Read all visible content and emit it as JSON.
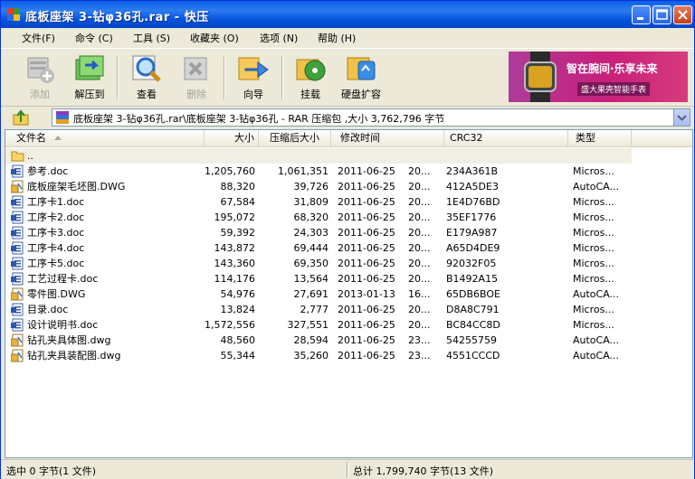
{
  "window": {
    "title": "底板座架 3-钻φ36孔.rar - 快压",
    "title_color": "#0A5FE6",
    "controls": [
      "minimize-icon",
      "maximize-icon",
      "close-icon"
    ]
  },
  "menu": [
    "文件(F)",
    "命令 (C)",
    "工具 (S)",
    "收藏夹 (O)",
    "选项 (N)",
    "帮助 (H)"
  ],
  "toolbar": {
    "add": "添加",
    "extract": "解压到",
    "view": "查看",
    "delete": "删除",
    "goto": "向导",
    "mount": "挂载",
    "disk": "硬盘扩容"
  },
  "ad": {
    "headline": "智在腕间·乐享未来",
    "sub": "盛大果壳智能手表"
  },
  "address": {
    "path": "底板座架 3-钻φ36孔.rar\\底板座架 3-钻φ36孔 - RAR 压缩包 ,大小 3,762,796 字节"
  },
  "columns": {
    "name": "文件名",
    "size": "大小",
    "packed": "压缩后大小",
    "modified": "修改时间",
    "crc": "CRC32",
    "type": "类型"
  },
  "parent_row": "..",
  "files": [
    {
      "name": "参考.doc",
      "icon": "word-doc-icon",
      "size": "1,205,760",
      "packed": "1,061,351",
      "date": "2011-06-25",
      "time": "20...",
      "crc": "234A361B",
      "type": "Micros..."
    },
    {
      "name": "底板座架毛坯图.DWG",
      "icon": "autocad-dwg-icon",
      "size": "88,320",
      "packed": "39,726",
      "date": "2011-06-25",
      "time": "20...",
      "crc": "412A5DE3",
      "type": "AutoCA..."
    },
    {
      "name": "工序卡1.doc",
      "icon": "word-doc-icon",
      "size": "67,584",
      "packed": "31,809",
      "date": "2011-06-25",
      "time": "20...",
      "crc": "1E4D76BD",
      "type": "Micros..."
    },
    {
      "name": "工序卡2.doc",
      "icon": "word-doc-icon",
      "size": "195,072",
      "packed": "68,320",
      "date": "2011-06-25",
      "time": "20...",
      "crc": "35EF1776",
      "type": "Micros..."
    },
    {
      "name": "工序卡3.doc",
      "icon": "word-doc-icon",
      "size": "59,392",
      "packed": "24,303",
      "date": "2011-06-25",
      "time": "20...",
      "crc": "E179A987",
      "type": "Micros..."
    },
    {
      "name": "工序卡4.doc",
      "icon": "word-doc-icon",
      "size": "143,872",
      "packed": "69,444",
      "date": "2011-06-25",
      "time": "20...",
      "crc": "A65D4DE9",
      "type": "Micros..."
    },
    {
      "name": "工序卡5.doc",
      "icon": "word-doc-icon",
      "size": "143,360",
      "packed": "69,350",
      "date": "2011-06-25",
      "time": "20...",
      "crc": "92032F05",
      "type": "Micros..."
    },
    {
      "name": "工艺过程卡.doc",
      "icon": "word-doc-icon",
      "size": "114,176",
      "packed": "13,564",
      "date": "2011-06-25",
      "time": "20...",
      "crc": "B1492A15",
      "type": "Micros..."
    },
    {
      "name": "零件图.DWG",
      "icon": "autocad-dwg-icon",
      "size": "54,976",
      "packed": "27,691",
      "date": "2013-01-13",
      "time": "16...",
      "crc": "65DB6BOE",
      "type": "AutoCA..."
    },
    {
      "name": "目录.doc",
      "icon": "word-doc-icon",
      "size": "13,824",
      "packed": "2,777",
      "date": "2011-06-25",
      "time": "20...",
      "crc": "D8A8C791",
      "type": "Micros..."
    },
    {
      "name": "设计说明书.doc",
      "icon": "word-doc-icon",
      "size": "1,572,556",
      "packed": "327,551",
      "date": "2011-06-25",
      "time": "20...",
      "crc": "BC84CC8D",
      "type": "Micros..."
    },
    {
      "name": "钻孔夹具体图.dwg",
      "icon": "autocad-dwg-icon",
      "size": "48,560",
      "packed": "28,594",
      "date": "2011-06-25",
      "time": "23...",
      "crc": "54255759",
      "type": "AutoCA..."
    },
    {
      "name": "钻孔夹具装配图.dwg",
      "icon": "autocad-dwg-icon",
      "size": "55,344",
      "packed": "35,260",
      "date": "2011-06-25",
      "time": "23...",
      "crc": "4551CCCD",
      "type": "AutoCA..."
    }
  ],
  "status": {
    "selected": "选中  0 字节(1 文件)",
    "total": "总计  1,799,740 字节(13 文件)"
  }
}
